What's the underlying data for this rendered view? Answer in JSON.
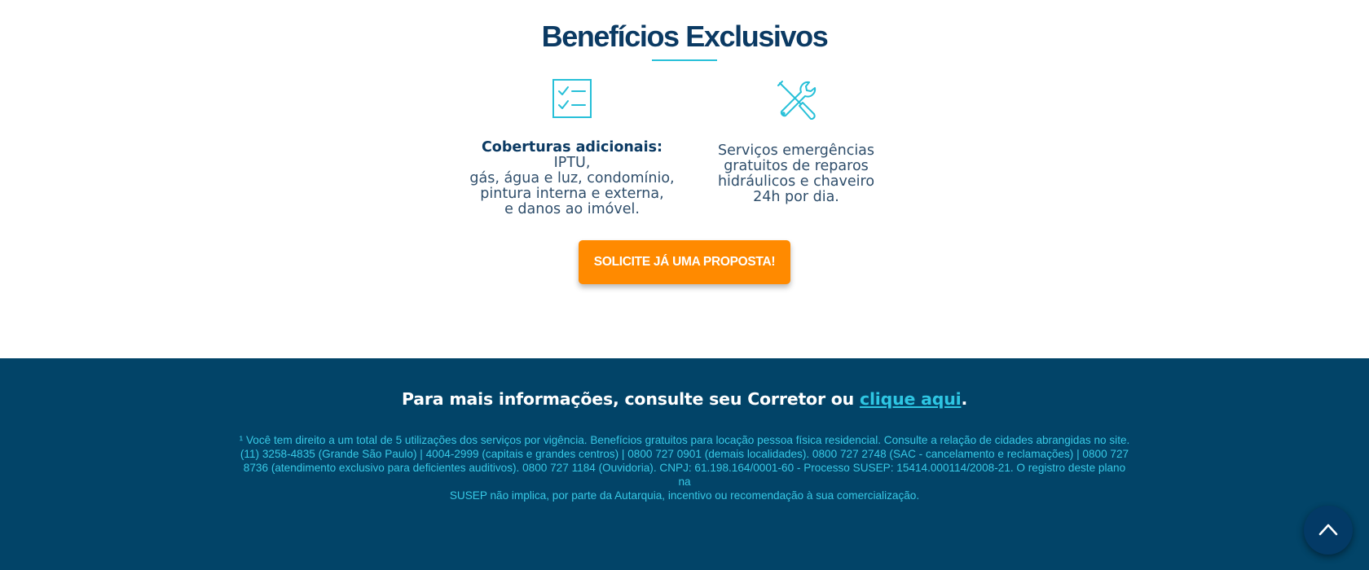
{
  "benefits": {
    "title": "Benefícios Exclusivos",
    "coverage": {
      "icon": "checklist-icon",
      "label": "Coberturas adicionais:",
      "line1_rest": " IPTU,",
      "line2": "gás, água e luz, condomínio,",
      "line3": "pintura interna e externa,",
      "line4": "e danos ao imóvel."
    },
    "services": {
      "icon": "tools-icon",
      "line1": "Serviços emergências",
      "line2": "gratuitos de reparos",
      "line3": "hidráulicos e chaveiro",
      "line4": "24h por dia."
    },
    "cta_label": "SOLICITE JÁ UMA PROPOSTA!"
  },
  "footer": {
    "headline_prefix": "Para mais informações, consulte seu Corretor ou ",
    "headline_link": "clique aqui",
    "headline_suffix": ".",
    "note_line1": "¹ Você tem direito a um total de 5 utilizações dos serviços por vigência. Benefícios gratuitos para locação pessoa física residencial. Consulte a relação de cidades abrangidas no site.",
    "note_line2": "(11) 3258-4835 (Grande São Paulo) | 4004-2999 (capitais e grandes centros) | 0800 727 0901 (demais localidades). 0800 727 2748 (SAC - cancelamento e reclamações) | 0800 727",
    "note_line3": "8736 (atendimento exclusivo para deficientes auditivos). 0800 727 1184 (Ouvidoria). CNPJ: 61.198.164/0001-60 - Processo SUSEP: 15414.000114/2008-21. O registro deste plano na",
    "note_line4": "SUSEP não implica, por parte da Autarquia, incentivo ou recomendação à sua comercialização."
  },
  "scroll_top": {
    "icon": "chevron-up-icon"
  },
  "colors": {
    "title": "#0b3a63",
    "accent": "#27c0d8",
    "cta": "#ff8a00",
    "footer_bg": "#024468",
    "footer_link": "#2ec6e3",
    "footer_note": "#37c9e6"
  }
}
